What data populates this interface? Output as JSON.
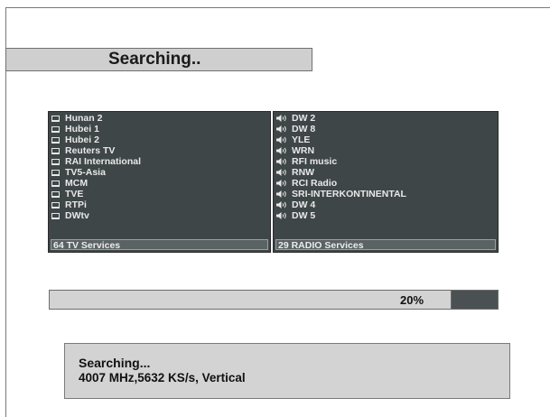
{
  "header": {
    "title": "Searching.."
  },
  "tv_list": {
    "items": [
      "Hunan 2",
      "Hubei 1",
      "Hubei 2",
      "Reuters TV",
      "RAI International",
      "TV5-Asia",
      "MCM",
      "TVE",
      "RTPi",
      "DWtv"
    ],
    "footer": "64 TV Services",
    "icon": "tv-icon"
  },
  "radio_list": {
    "items": [
      "DW 2",
      "DW 8",
      "YLE",
      "WRN",
      "RFI music",
      "RNW",
      "RCI Radio",
      "SRI-INTERKONTINENTAL",
      "DW 4",
      "DW 5"
    ],
    "footer": "29  RADIO Services",
    "icon": "speaker-icon"
  },
  "progress": {
    "percent_label": "20%",
    "fill_fraction": 0.895
  },
  "status": {
    "line1": "Searching...",
    "line2": "4007 MHz,5632 KS/s, Vertical"
  },
  "colors": {
    "panel": "#3f4648",
    "progress_fill": "#d3d3d3",
    "progress_track": "#4b5153",
    "info_box": "#d3d3d3"
  }
}
